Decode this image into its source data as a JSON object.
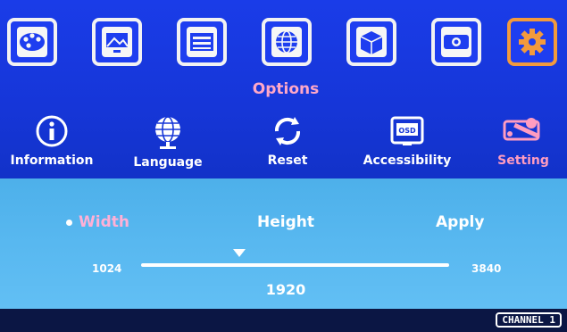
{
  "header": {
    "title": "Options"
  },
  "toolbar": {
    "icons": [
      "palette-icon",
      "picture-icon",
      "audio-mixer-icon",
      "globe-icon",
      "3d-box-icon",
      "projector-icon",
      "gear-icon"
    ],
    "active_index": 6,
    "active_color": "#f39a3c"
  },
  "submenu": {
    "items": [
      {
        "label": "Information",
        "icon": "info-icon"
      },
      {
        "label": "Language",
        "icon": "globe-icon"
      },
      {
        "label": "Reset",
        "icon": "reset-icon"
      },
      {
        "label": "Accessibility",
        "icon": "osd-icon",
        "icon_text": "OSD"
      },
      {
        "label": "Setting",
        "icon": "setting-tools-icon"
      }
    ],
    "active_index": 4
  },
  "setting": {
    "tabs": [
      "Width",
      "Height",
      "Apply"
    ],
    "active_tab": 0,
    "slider": {
      "min_label": "1024",
      "max_label": "3840",
      "min": 1024,
      "max": 3840,
      "value": 1920,
      "value_label": "1920"
    }
  },
  "footer": {
    "channel": "CHANNEL 1"
  },
  "colors": {
    "background": "#1636d8",
    "panel": "#58b8f0",
    "highlight": "#ffa8c8",
    "bar": "#0b1644"
  }
}
